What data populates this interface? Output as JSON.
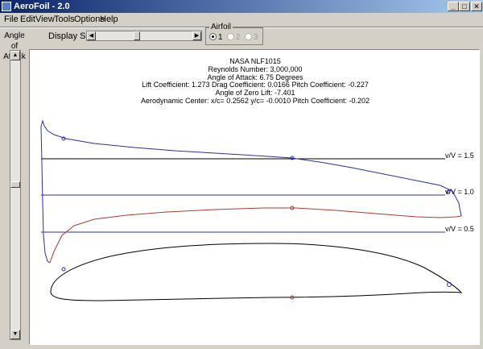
{
  "window": {
    "title": "AeroFoil - 2.0",
    "buttons": {
      "minimize": "_",
      "maximize": "□",
      "close": "✕"
    }
  },
  "menu": [
    "File",
    "Edit",
    "View",
    "Tools",
    "Options",
    "Help"
  ],
  "controls": {
    "angle_label_line1": "Angle of",
    "angle_label_line2": "Attack",
    "display_scale_label": "Display Scale",
    "airfoil_group_label": "Airfoil",
    "airfoil_options": [
      "1",
      "2",
      "3"
    ],
    "airfoil_selected": "1",
    "angle_slider_value_fraction": 0.46,
    "display_scale_value_fraction": 0.42
  },
  "results": {
    "airfoil_name": "NASA  NLF1015",
    "reynolds": "Reynolds Number: 3,000,000",
    "angle_of_attack": "Angle of Attack: 6.75 Degrees",
    "coefficients": "Lift Coefficient: 1.273   Drag Coefficient: 0.0166   Pitch Coefficient: -0.227",
    "zero_lift": "Angle of Zero Lift: -7.401",
    "aero_center": "Aerodynamic Center: x/c= 0.2562  y/c= -0.0010   Pitch Coefficient: -0.202"
  },
  "plot": {
    "velocity_labels": [
      "v/V = 1.5",
      "v/V = 1.0",
      "v/V = 0.5"
    ],
    "colors": {
      "upper_surface": "#2b2fa8",
      "lower_surface": "#b03a2e",
      "reference_line_1.5": "#000000",
      "reference_line_1.0": "#2b2fa8",
      "reference_line_0.5": "#2b2fa8",
      "airfoil_outline": "#000000"
    }
  }
}
